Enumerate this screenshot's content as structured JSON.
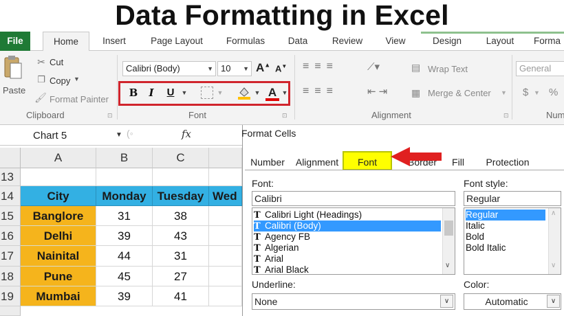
{
  "title": "Data Formatting in Excel",
  "ribbon": {
    "tabs": [
      "File",
      "Home",
      "Insert",
      "Page Layout",
      "Formulas",
      "Data",
      "Review",
      "View",
      "Design",
      "Layout",
      "Forma"
    ],
    "clipboard": {
      "paste": "Paste",
      "cut": "Cut",
      "copy": "Copy",
      "format_painter": "Format Painter",
      "group": "Clipboard"
    },
    "font": {
      "font_name": "Calibri (Body)",
      "font_size": "10",
      "bold": "B",
      "italic": "I",
      "underline": "U",
      "font_color_glyph": "A",
      "group": "Font"
    },
    "alignment": {
      "wrap_text": "Wrap Text",
      "merge_center": "Merge & Center",
      "group": "Alignment"
    },
    "number": {
      "format": "General",
      "currency": "$",
      "percent": "%",
      "group": "Num"
    }
  },
  "formula_bar": {
    "name_box": "Chart 5",
    "fx": "fx"
  },
  "sheet": {
    "columns": [
      "A",
      "B",
      "C"
    ],
    "rows": [
      "13",
      "14",
      "15",
      "16",
      "17",
      "18",
      "19"
    ],
    "header": [
      "City",
      "Monday",
      "Tuesday",
      "Wed"
    ],
    "data": [
      {
        "city": "Banglore",
        "mon": "31",
        "tue": "38"
      },
      {
        "city": "Delhi",
        "mon": "39",
        "tue": "43"
      },
      {
        "city": "Nainital",
        "mon": "44",
        "tue": "31"
      },
      {
        "city": "Pune",
        "mon": "45",
        "tue": "27"
      },
      {
        "city": "Mumbai",
        "mon": "39",
        "tue": "41"
      }
    ]
  },
  "dialog": {
    "title": "Format Cells",
    "tabs": [
      "Number",
      "Alignment",
      "Font",
      "Border",
      "Fill",
      "Protection"
    ],
    "font_label": "Font:",
    "font_value": "Calibri",
    "font_list": [
      "Calibri Light (Headings)",
      "Calibri (Body)",
      "Agency FB",
      "Algerian",
      "Arial",
      "Arial Black"
    ],
    "selected_font_index": 1,
    "style_label": "Font style:",
    "style_value": "Regular",
    "style_list": [
      "Regular",
      "Italic",
      "Bold",
      "Bold Italic"
    ],
    "underline_label": "Underline:",
    "underline_value": "None",
    "color_label": "Color:",
    "color_value": "Automatic"
  },
  "colors": {
    "header_fill": "#33b0e3",
    "city_fill": "#f5b41c",
    "highlight_box": "#d0242c",
    "font_tab_highlight": "#ffff00",
    "arrow": "#e02020",
    "selection": "#3399ff"
  }
}
